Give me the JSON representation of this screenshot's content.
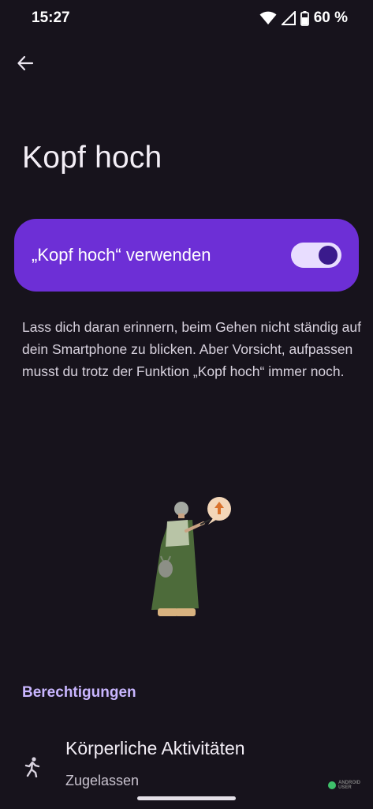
{
  "status": {
    "time": "15:27",
    "battery": "60 %",
    "icons": [
      "wifi-icon",
      "signal-icon",
      "battery-icon"
    ]
  },
  "header": {
    "back_icon": "arrow-back-icon",
    "title": "Kopf hoch"
  },
  "main_switch": {
    "label": "„Kopf hoch“ verwenden",
    "enabled": true,
    "color": "#6d2fd6"
  },
  "description": "Lass dich daran erinnern, beim Gehen nicht ständig auf dein Smartphone zu blicken. Aber Vorsicht, aufpassen musst du trotz der Funktion „Kopf hoch“ immer noch.",
  "permissions": {
    "header": "Berechtigungen",
    "items": [
      {
        "icon": "walking-icon",
        "title": "Körperliche Aktivitäten",
        "subtitle": "Zugelassen"
      }
    ]
  },
  "watermark": {
    "line1": "ANDROID",
    "line2": "USER"
  }
}
